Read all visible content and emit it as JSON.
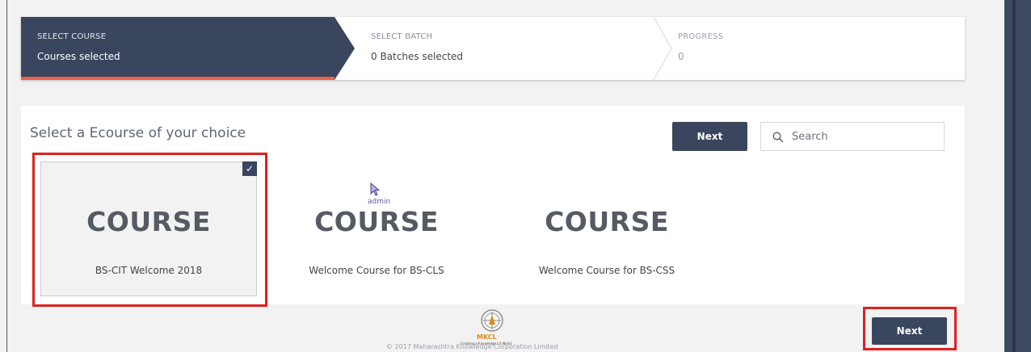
{
  "stepper": {
    "steps": [
      {
        "label": "SELECT COURSE",
        "value": "Courses selected"
      },
      {
        "label": "SELECT BATCH",
        "value": "0 Batches selected"
      },
      {
        "label": "PROGRESS",
        "value": "0"
      }
    ]
  },
  "panel": {
    "title": "Select a Ecourse of your choice",
    "next_label": "Next",
    "search_placeholder": "Search"
  },
  "courses": [
    {
      "image_text": "COURSE",
      "name": "BS-CIT Welcome 2018",
      "selected": true,
      "check": "✓"
    },
    {
      "image_text": "COURSE",
      "name": "Welcome Course for BS-CLS",
      "selected": false
    },
    {
      "image_text": "COURSE",
      "name": "Welcome Course for BS-CSS",
      "selected": false
    }
  ],
  "overlay": {
    "cursor_tooltip": "admin"
  },
  "footer": {
    "logo_text": "MKCL",
    "logo_tagline": "Creating a Knowledge Lit World",
    "copyright": "© 2017 Maharashtra Knowledge Corporation Limited",
    "next_label": "Next"
  },
  "colors": {
    "primary": "#3a465d",
    "accent": "#e8604c",
    "highlight": "#e02020"
  },
  "icons": {
    "search": "search-icon",
    "check": "check-icon",
    "cursor": "mouse-cursor-icon",
    "logo": "mkcl-logo-icon"
  }
}
